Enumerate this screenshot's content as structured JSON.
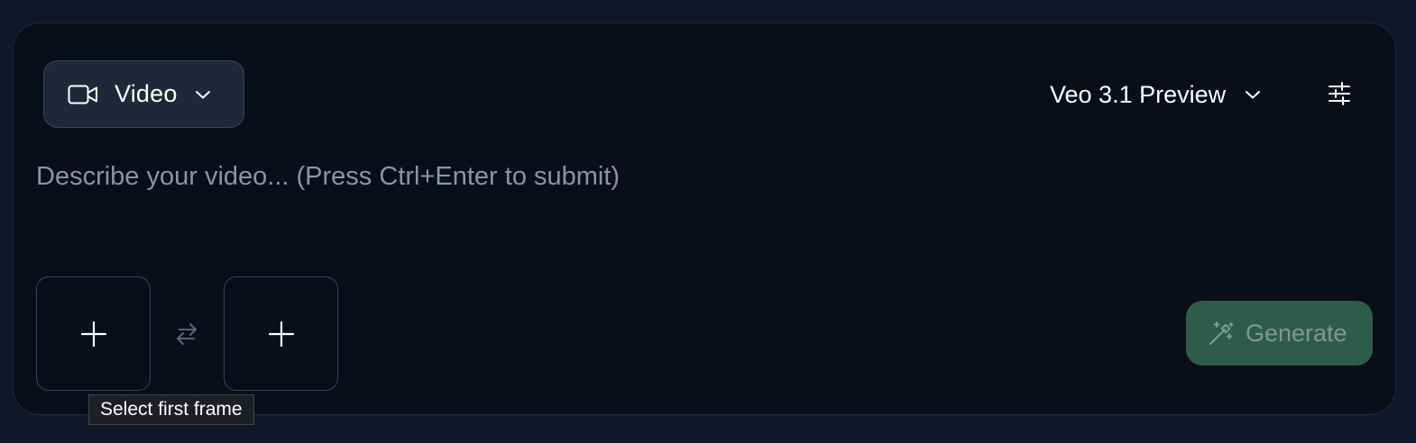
{
  "mode": {
    "label": "Video",
    "icon": "video-camera-icon"
  },
  "model": {
    "label": "Veo 3.1 Preview"
  },
  "settings": {
    "icon": "sliders-icon"
  },
  "prompt": {
    "placeholder": "Describe your video... (Press Ctrl+Enter to submit)",
    "value": ""
  },
  "frames": {
    "first_icon": "plus-icon",
    "last_icon": "plus-icon",
    "swap_icon": "swap-arrows-icon",
    "tooltip": "Select first frame"
  },
  "generate": {
    "label": "Generate",
    "icon": "magic-wand-icon",
    "enabled": false
  },
  "colors": {
    "background": "#111729",
    "panel": "#0a0e18",
    "mode_button_bg": "#1f2838",
    "generate_bg": "#2d5c4b",
    "generate_text": "#7f9891",
    "placeholder": "#8a94a6"
  }
}
